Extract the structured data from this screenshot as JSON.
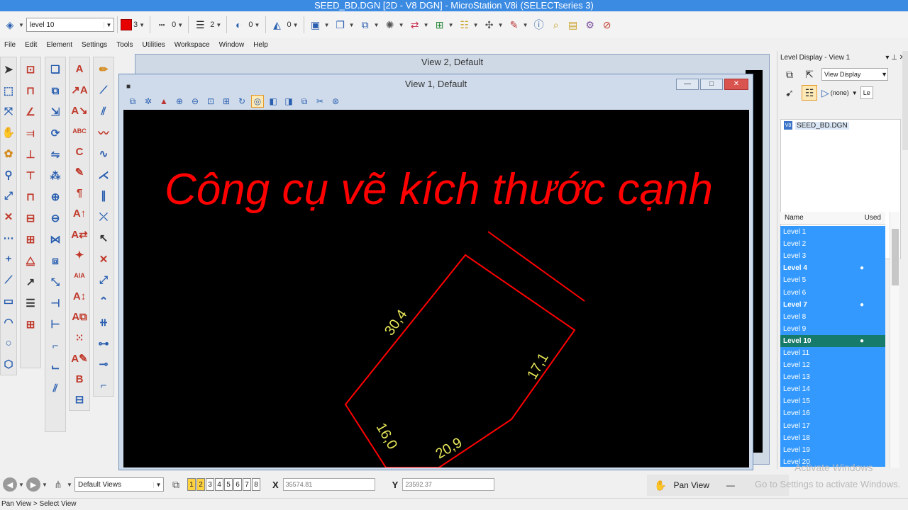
{
  "window": {
    "title": "SEED_BD.DGN [2D - V8 DGN] - MicroStation V8i (SELECTseries 3)"
  },
  "toolbar": {
    "level_combo": "level 10",
    "color_value": "3",
    "style_value": "0",
    "weight_value": "2",
    "transparency_value": "0",
    "priority_value": "0",
    "colors": {
      "active_color": "#e60000"
    }
  },
  "menu": [
    "File",
    "Edit",
    "Element",
    "Settings",
    "Tools",
    "Utilities",
    "Workspace",
    "Window",
    "Help"
  ],
  "view2": {
    "title": "View 2, Default"
  },
  "view1": {
    "title": "View 1, Default",
    "heading": "Công cụ vẽ kích thước cạnh",
    "dimensions": [
      "30,4",
      "17,1",
      "20,9",
      "16,0"
    ]
  },
  "level_display": {
    "title": "Level Display - View 1",
    "view_display_combo": "View Display",
    "filter_combo": "(none)",
    "filter_extra": "Le",
    "file_name": "SEED_BD.DGN",
    "col_name": "Name",
    "col_used": "Used",
    "levels": [
      {
        "name": "Level 1",
        "used": false,
        "active": false
      },
      {
        "name": "Level 2",
        "used": false,
        "active": false
      },
      {
        "name": "Level 3",
        "used": false,
        "active": false
      },
      {
        "name": "Level 4",
        "used": true,
        "active": false
      },
      {
        "name": "Level 5",
        "used": false,
        "active": false
      },
      {
        "name": "Level 6",
        "used": false,
        "active": false
      },
      {
        "name": "Level 7",
        "used": true,
        "active": false
      },
      {
        "name": "Level 8",
        "used": false,
        "active": false
      },
      {
        "name": "Level 9",
        "used": false,
        "active": false
      },
      {
        "name": "Level 10",
        "used": true,
        "active": true
      },
      {
        "name": "Level 11",
        "used": false,
        "active": false
      },
      {
        "name": "Level 12",
        "used": false,
        "active": false
      },
      {
        "name": "Level 13",
        "used": false,
        "active": false
      },
      {
        "name": "Level 14",
        "used": false,
        "active": false
      },
      {
        "name": "Level 15",
        "used": false,
        "active": false
      },
      {
        "name": "Level 16",
        "used": false,
        "active": false
      },
      {
        "name": "Level 17",
        "used": false,
        "active": false
      },
      {
        "name": "Level 18",
        "used": false,
        "active": false
      },
      {
        "name": "Level 19",
        "used": false,
        "active": false
      },
      {
        "name": "Level 20",
        "used": false,
        "active": false
      }
    ]
  },
  "bottom": {
    "view_combo": "Default Views",
    "view_buttons": [
      "1",
      "2",
      "3",
      "4",
      "5",
      "6",
      "7",
      "8"
    ],
    "x_label": "X",
    "x_value": "35574.81",
    "y_label": "Y",
    "y_value": "23592.37",
    "tool_name": "Pan View",
    "watermark_title": "Activate Windows",
    "watermark_text": "Go to Settings to activate Windows."
  },
  "status": {
    "text": "Pan View > Select View"
  }
}
